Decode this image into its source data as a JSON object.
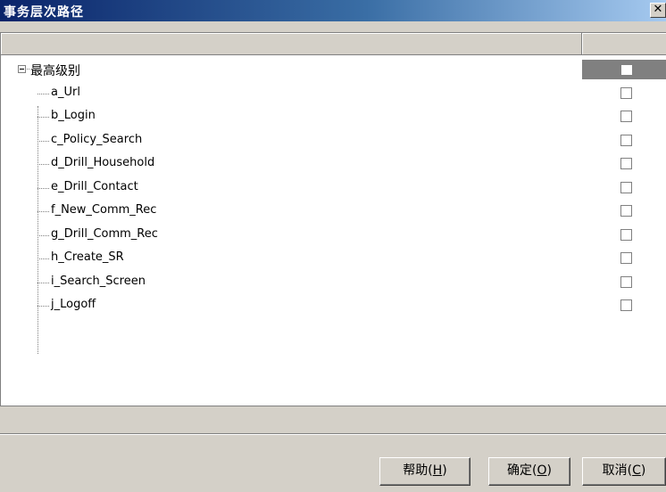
{
  "window": {
    "title": "事务层次路径",
    "close_label": "✕"
  },
  "tree": {
    "root": {
      "label": "最高级别"
    },
    "children": [
      {
        "label": "a_Url"
      },
      {
        "label": "b_Login"
      },
      {
        "label": "c_Policy_Search"
      },
      {
        "label": "d_Drill_Household"
      },
      {
        "label": "e_Drill_Contact"
      },
      {
        "label": "f_New_Comm_Rec"
      },
      {
        "label": "g_Drill_Comm_Rec"
      },
      {
        "label": "h_Create_SR"
      },
      {
        "label": "i_Search_Screen"
      },
      {
        "label": "j_Logoff"
      }
    ]
  },
  "buttons": {
    "help": {
      "text": "帮助(",
      "key": "H",
      "end": ")"
    },
    "ok": {
      "text": "确定(",
      "key": "O",
      "end": ")"
    },
    "cancel": {
      "text": "取消(",
      "key": "C",
      "end": ")"
    }
  }
}
